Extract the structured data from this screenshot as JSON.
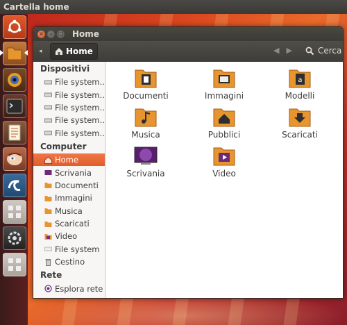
{
  "panel": {
    "title": "Cartella home"
  },
  "launcher": {
    "items": [
      "ubuntu-logo-icon",
      "files-icon",
      "eye-icon",
      "terminal-icon",
      "text-editor-icon",
      "face-icon",
      "swirl-icon",
      "grid-icon",
      "settings-icon",
      "grid-icon"
    ]
  },
  "window": {
    "title": "Home",
    "breadcrumb": "Home",
    "search_label": "Cerca"
  },
  "sidebar": {
    "devices_header": "Dispositivi",
    "devices": [
      "File system…",
      "File system…",
      "File system…",
      "File system…",
      "File system…"
    ],
    "computer_header": "Computer",
    "computer": [
      "Home",
      "Scrivania",
      "Documenti",
      "Immagini",
      "Musica",
      "Scaricati",
      "Video",
      "File system",
      "Cestino"
    ],
    "network_header": "Rete",
    "network": [
      "Esplora rete"
    ]
  },
  "files": [
    "Documenti",
    "Immagini",
    "Modelli",
    "Musica",
    "Pubblici",
    "Scaricati",
    "Scrivania",
    "Video"
  ],
  "colors": {
    "accent": "#e46331",
    "folder": "#e6952f",
    "panel": "#3c3b37"
  }
}
